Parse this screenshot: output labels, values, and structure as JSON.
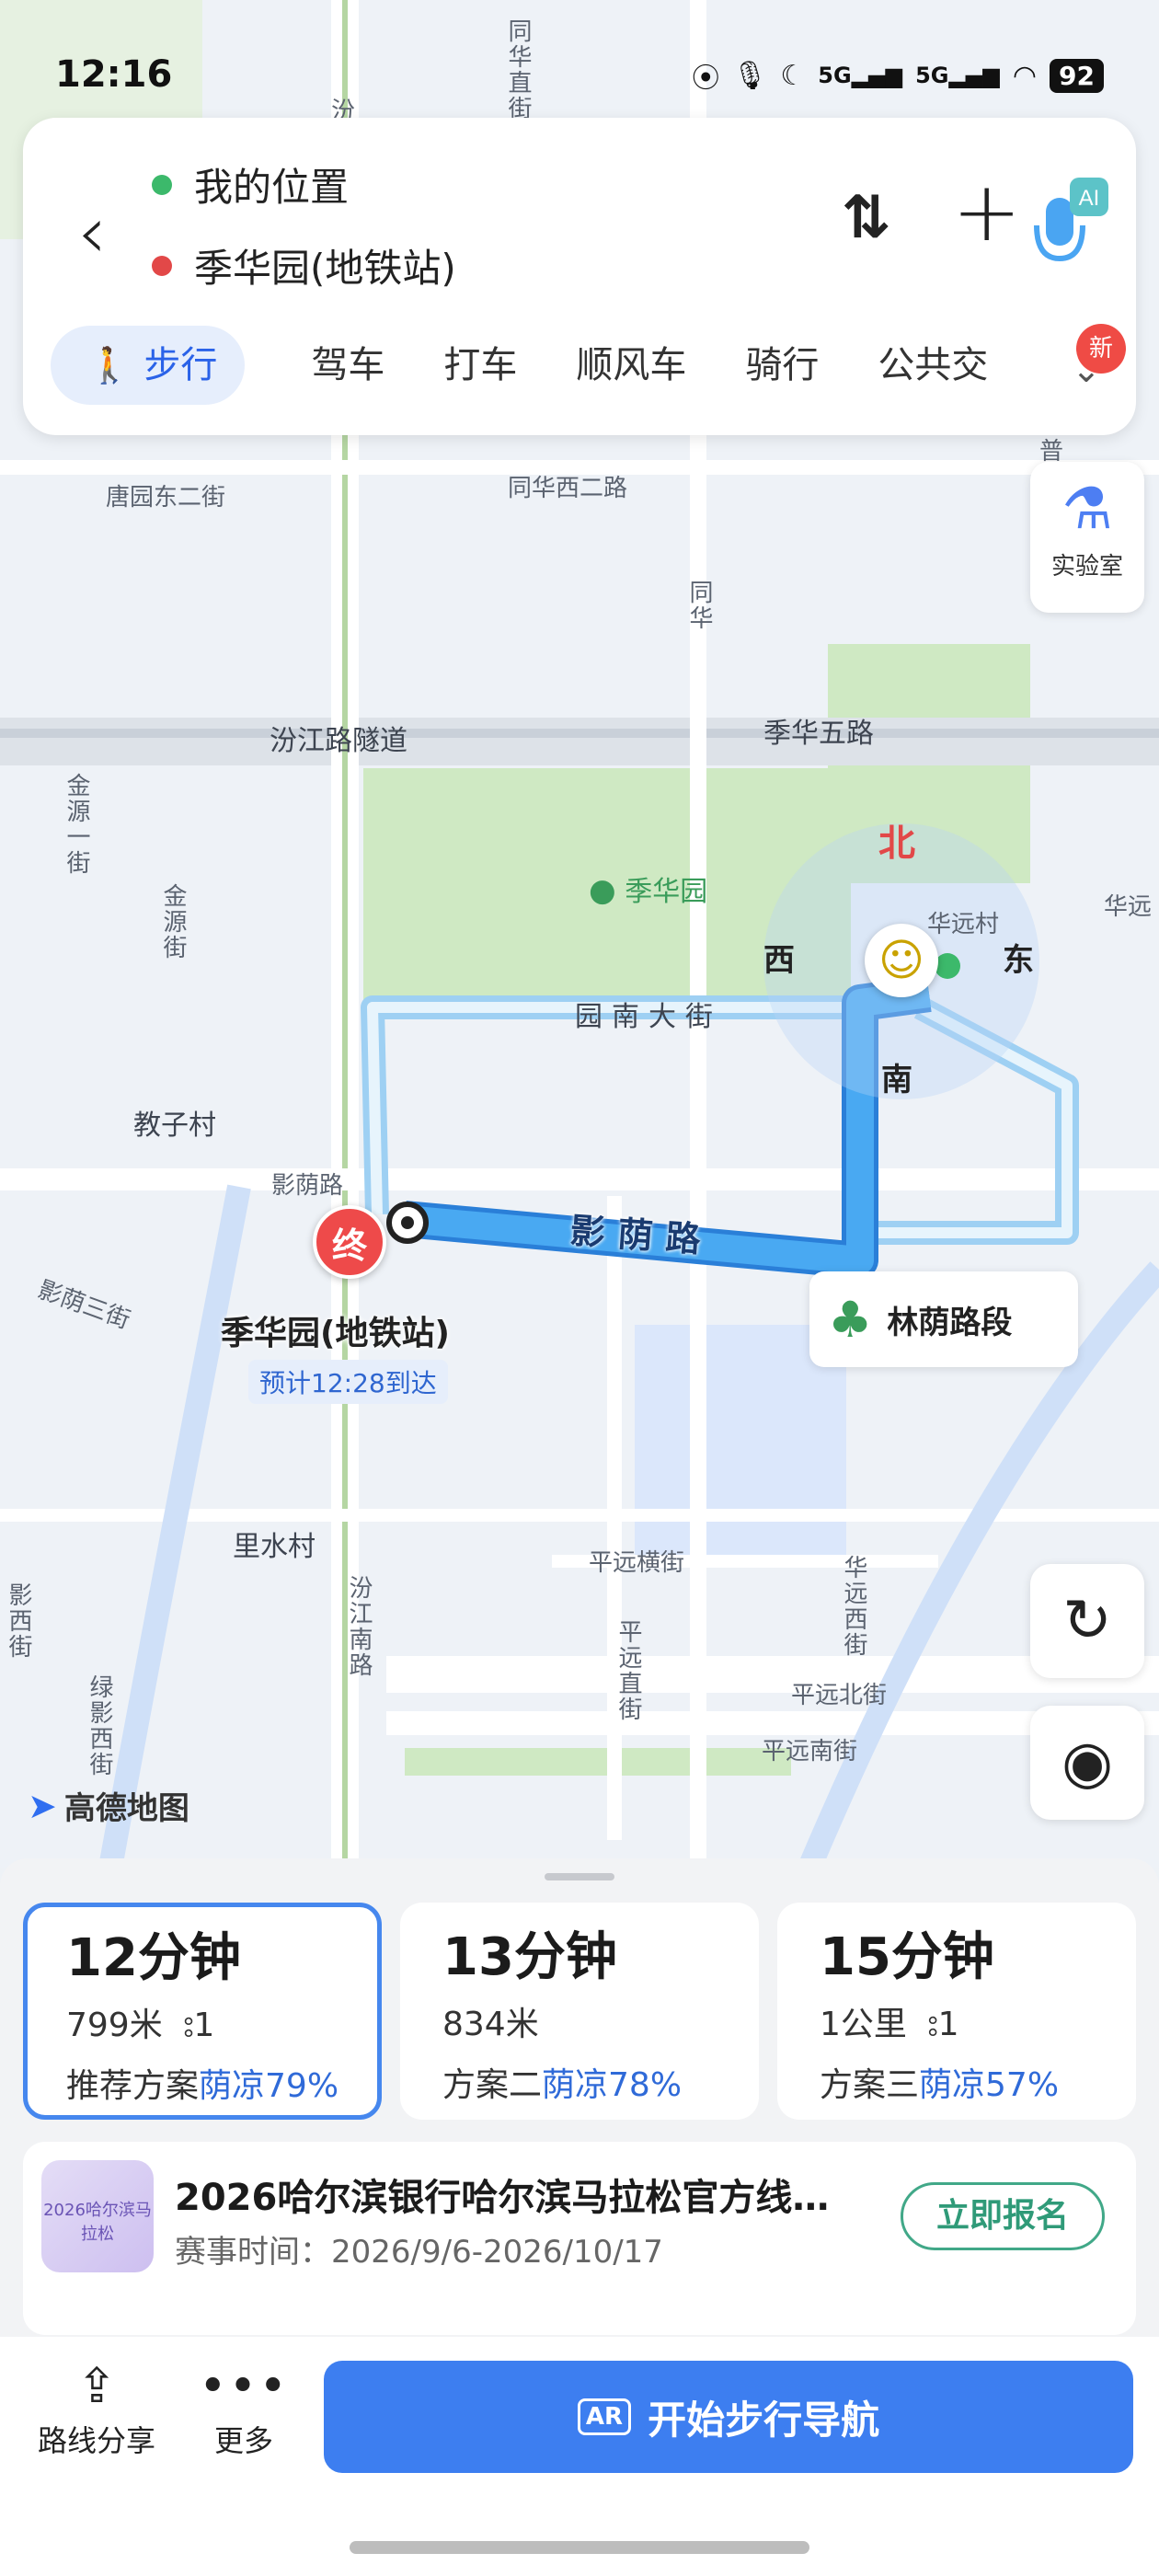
{
  "status_bar": {
    "time": "12:16",
    "signal1": "5G",
    "signal2": "5G",
    "battery": "92"
  },
  "route_header": {
    "origin": "我的位置",
    "destination": "季华园(地铁站)",
    "origin_color": "#3cb96b",
    "destination_color": "#e24848",
    "ai_badge": "AI",
    "tabs": [
      "步行",
      "驾车",
      "打车",
      "顺风车",
      "骑行",
      "公共交"
    ],
    "new_badge": "新"
  },
  "lab_button": {
    "label": "实验室"
  },
  "map": {
    "labels": {
      "tangyuan": "唐园东二街",
      "tongxi": "同华西二路",
      "tonghua_v": "同华直街",
      "tonghua_v2": "同华",
      "fenjiang": "汾江路隧道",
      "jihua5": "季华五路",
      "jinyuan1": "金源一街",
      "jinyuan_st": "金源街",
      "jihuayuan": "季华园",
      "huayuancun": "华远村",
      "huayuan_r": "华远",
      "yuannan": "园南大街",
      "jiaozi": "教子村",
      "yingyin_small": "影荫路",
      "yingyin_main": "影荫路",
      "yingyin3": "影荫三街",
      "lishui": "里水村",
      "pingyuan_heng": "平远横街",
      "pingyuan_v": "平远直街",
      "fenjiang_nan": "汾江南路",
      "huayuan_xi": "华远西街",
      "pingyuan_bei": "平远北街",
      "pingyuan_nan": "平远南街",
      "lv_ying": "绿影西街",
      "ying_xi": "影西街",
      "fen_top": "汾",
      "pu": "普"
    },
    "compass": {
      "north": "北",
      "south": "南",
      "west": "西",
      "east": "东"
    },
    "destination_marker": "终",
    "destination_name": "季华园(地铁站)",
    "eta": "预计12:28到达",
    "shade_segment": "林荫路段",
    "logo": "高德地图",
    "route_color": "#3d9be9"
  },
  "routes": [
    {
      "time": "12分钟",
      "distance": "799米",
      "lights": "1",
      "plan": "推荐方案",
      "shade": "荫凉79%"
    },
    {
      "time": "13分钟",
      "distance": "834米",
      "lights": "",
      "plan": "方案二",
      "shade": "荫凉78%"
    },
    {
      "time": "15分钟",
      "distance": "1公里",
      "lights": "1",
      "plan": "方案三",
      "shade": "荫凉57%"
    }
  ],
  "ad": {
    "title": "2026哈尔滨银行哈尔滨马拉松官方线…",
    "time": "赛事时间：2026/9/6-2026/10/17",
    "button": "立即报名",
    "thumb_text": "2026哈尔滨马拉松"
  },
  "bottom_bar": {
    "share": "路线分享",
    "more": "更多",
    "start": "开始步行导航",
    "ar": "AR"
  }
}
